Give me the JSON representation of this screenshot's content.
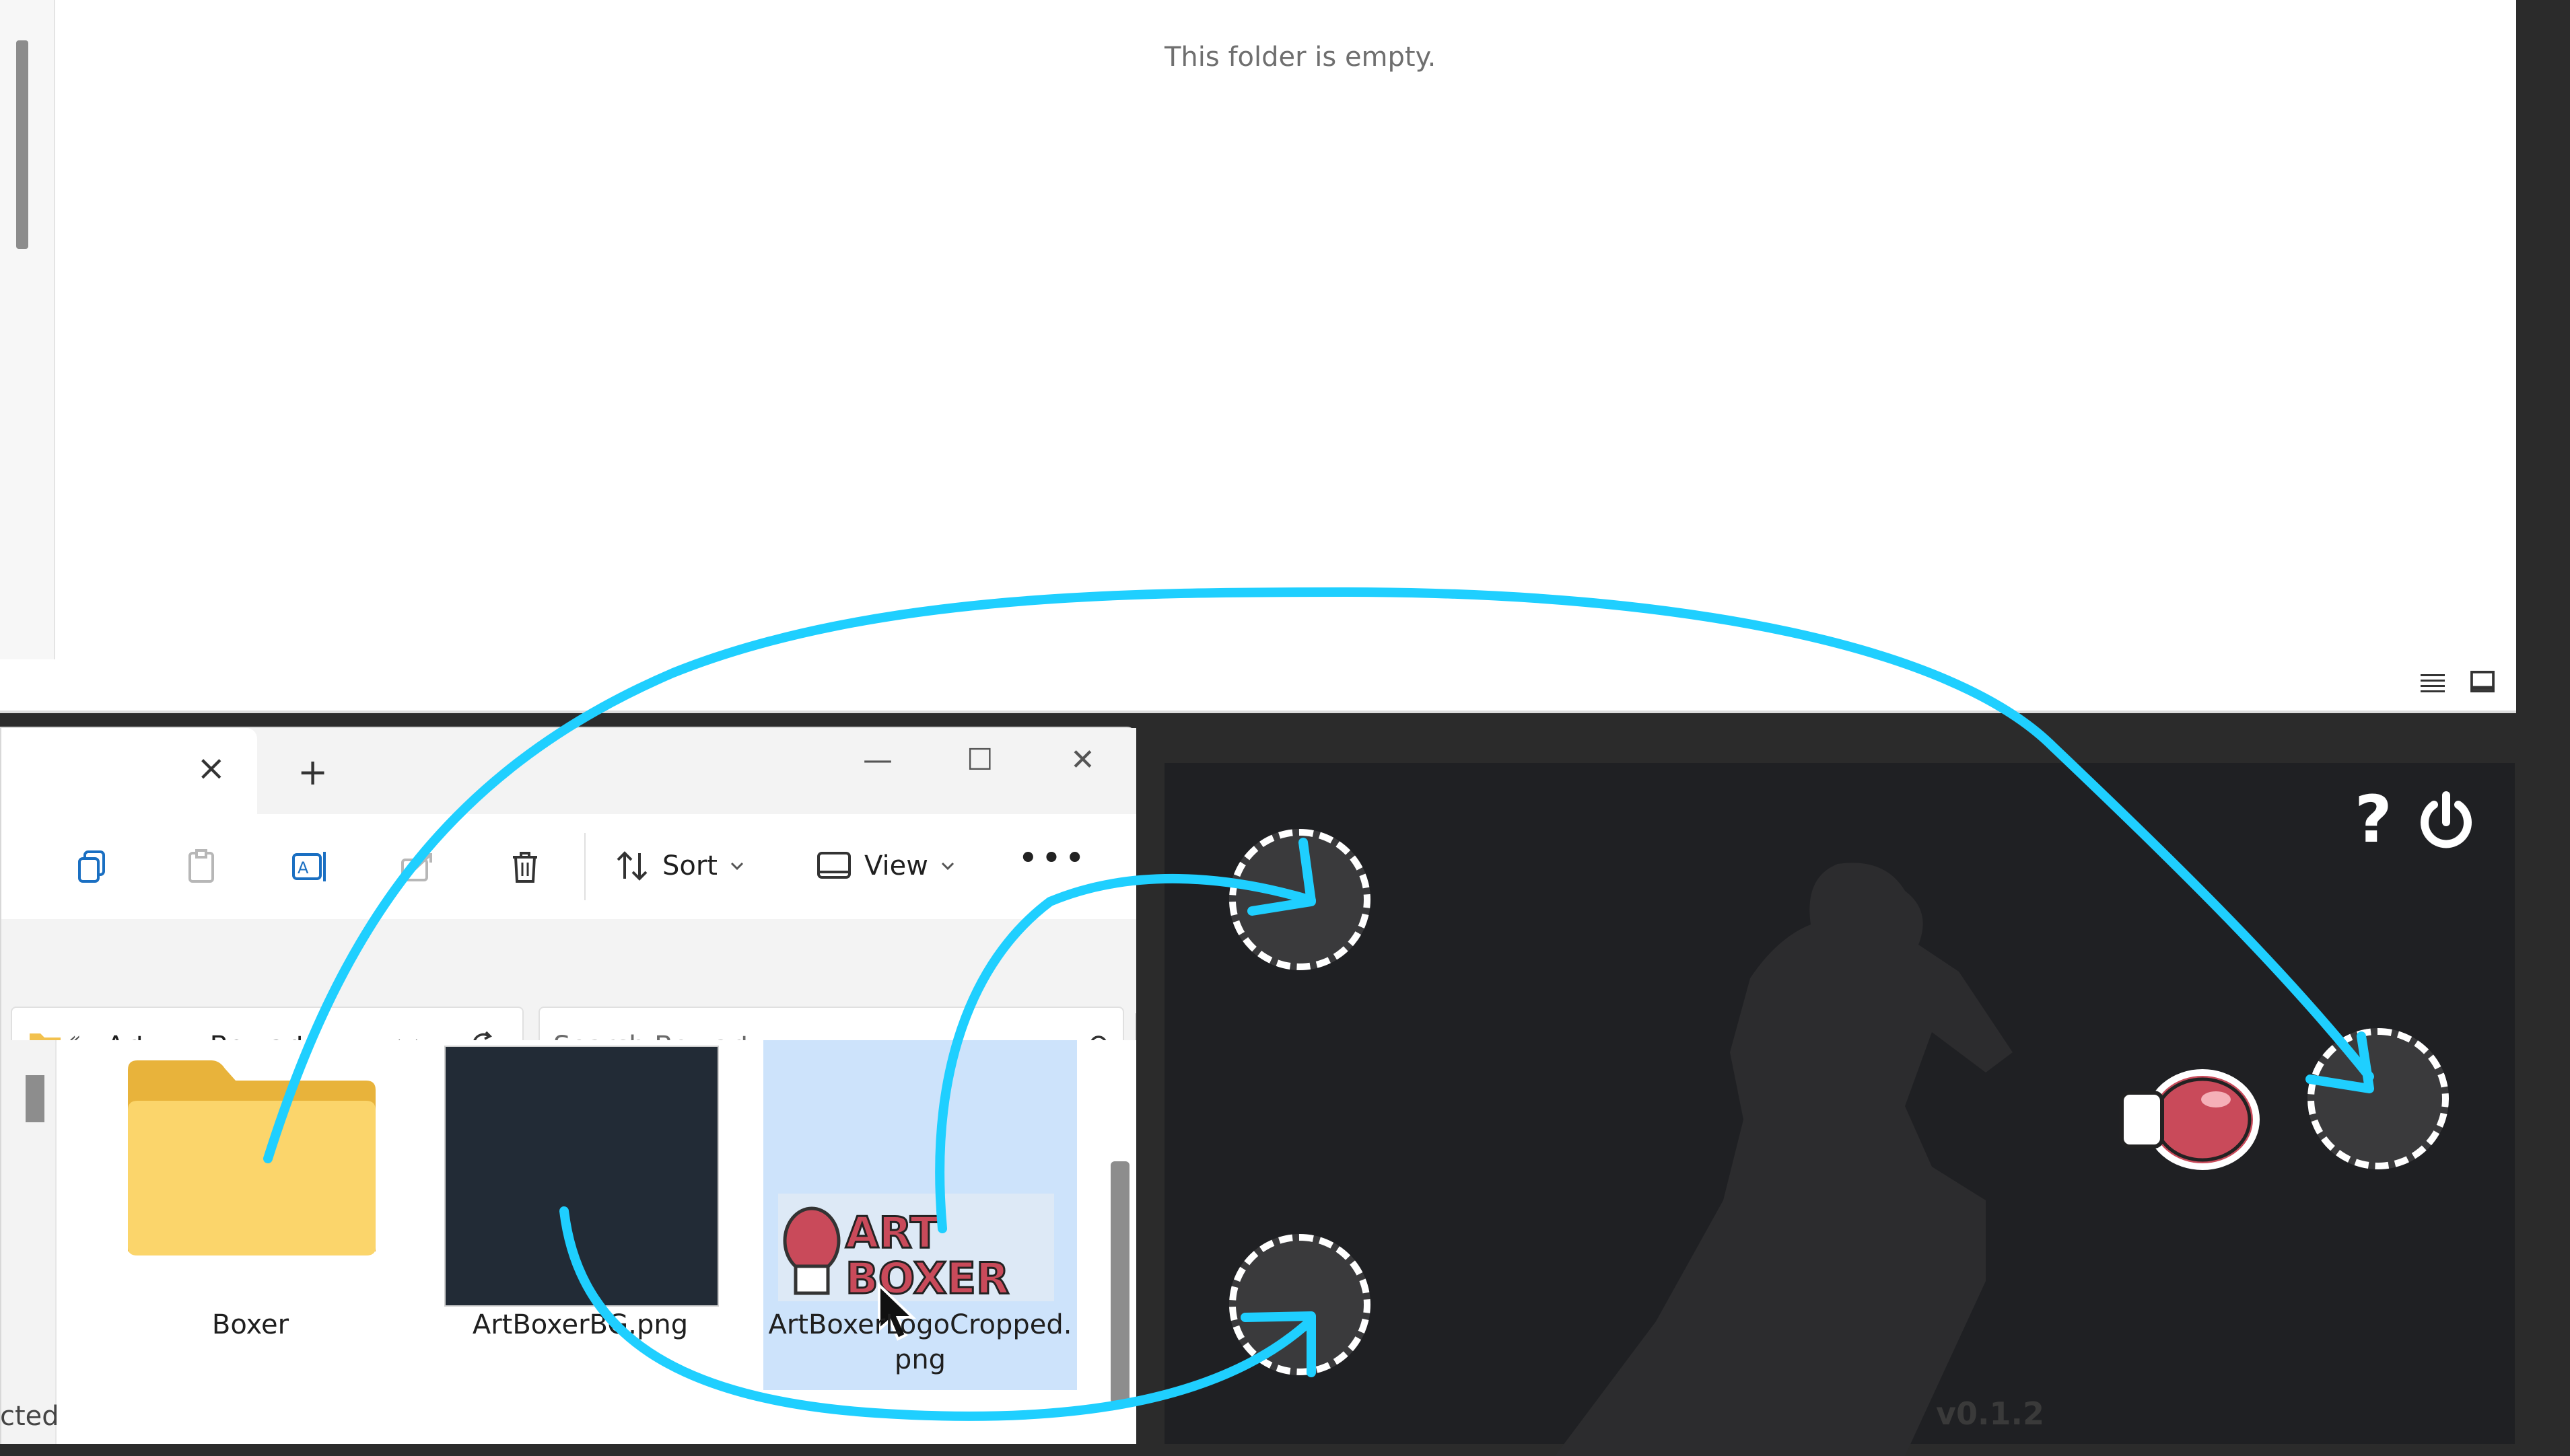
{
  "top_window": {
    "empty_message": "This folder is empty."
  },
  "explorer": {
    "tab_close_glyph": "×",
    "new_tab_glyph": "+",
    "window_controls": {
      "minimize": "—",
      "maximize": "☐",
      "close": "✕"
    },
    "toolbar": {
      "sort_label": "Sort",
      "view_label": "View",
      "more_label": "•••"
    },
    "address": {
      "overflow": "«",
      "crumbs": [
        "Art...",
        "Box art"
      ],
      "separator": "›"
    },
    "search": {
      "placeholder": "Search Box art"
    },
    "files": [
      {
        "name": "Boxer",
        "type": "folder"
      },
      {
        "name": "ArtBoxerBG.png",
        "type": "image"
      },
      {
        "name": "ArtBoxerLogoCropped.png",
        "type": "image"
      }
    ],
    "file_label_lines": {
      "f0": "Boxer",
      "f1": "ArtBoxerBG.png",
      "f2_line1": "ArtBoxerLogoCropped.",
      "f2_line2": "png"
    },
    "status": "cted"
  },
  "game": {
    "version": "v0.1.2",
    "help_icon": "?",
    "colors": {
      "background": "#1f2023",
      "arrow": "#1fcfff",
      "silhouette": "#2c2c2e",
      "glove": "#c94a5a"
    }
  }
}
